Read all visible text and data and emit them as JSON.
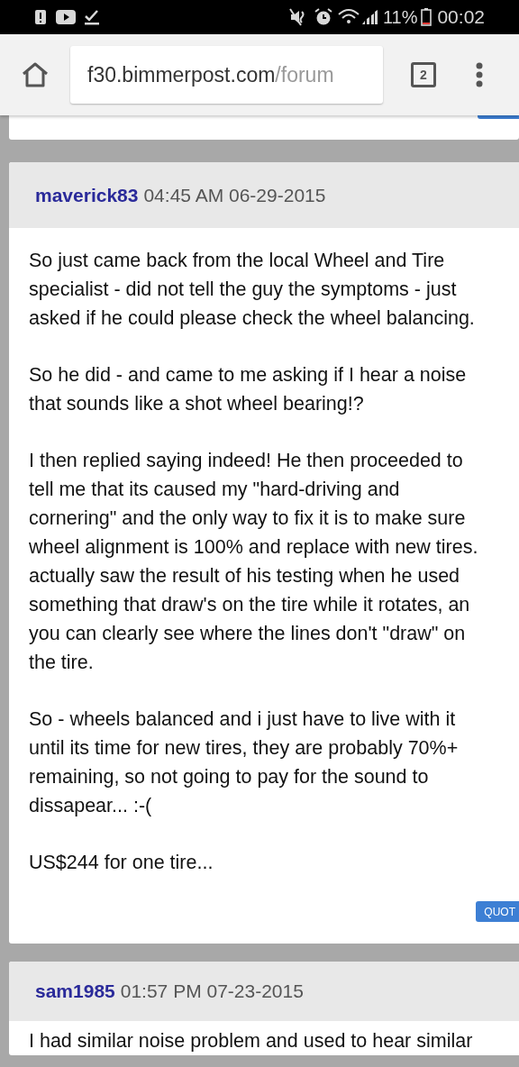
{
  "status_bar": {
    "battery": "11%",
    "time": "00:02"
  },
  "browser": {
    "url_host": "f30.bimmerpost.com",
    "url_path": "/forum",
    "tab_count": "2"
  },
  "posts": [
    {
      "username": "maverick83",
      "timestamp": "04:45 AM 06-29-2015",
      "paragraphs": [
        [
          "So just came back from the local Wheel and Tire",
          "specialist - did not tell the guy the symptoms - just",
          "asked if he could please check the wheel balancing."
        ],
        [
          "So he did - and came to me asking if I hear a noise",
          "that sounds like a shot wheel bearing!?"
        ],
        [
          "I then replied saying indeed! He then proceeded to",
          "tell me that its caused my \"hard-driving and",
          "cornering\" and the only way to fix it is to make sure",
          "wheel alignment is 100% and replace with new tires.",
          "actually saw the result of his testing when he used",
          "something that draw's on the tire while it rotates, an",
          "you can clearly see where the lines don't \"draw\" on",
          "the tire."
        ],
        [
          "So - wheels balanced and i just have to live with it",
          "until its time for new tires, they are probably 70%+",
          "remaining, so not going to pay for the sound to",
          "dissapear... :-("
        ],
        [
          "US$244 for one tire..."
        ]
      ],
      "quote_label": "QUOT"
    },
    {
      "username": "sam1985",
      "timestamp": "01:57 PM 07-23-2015",
      "paragraphs": [
        [
          "I had similar noise problem and used to hear similar"
        ]
      ]
    }
  ]
}
